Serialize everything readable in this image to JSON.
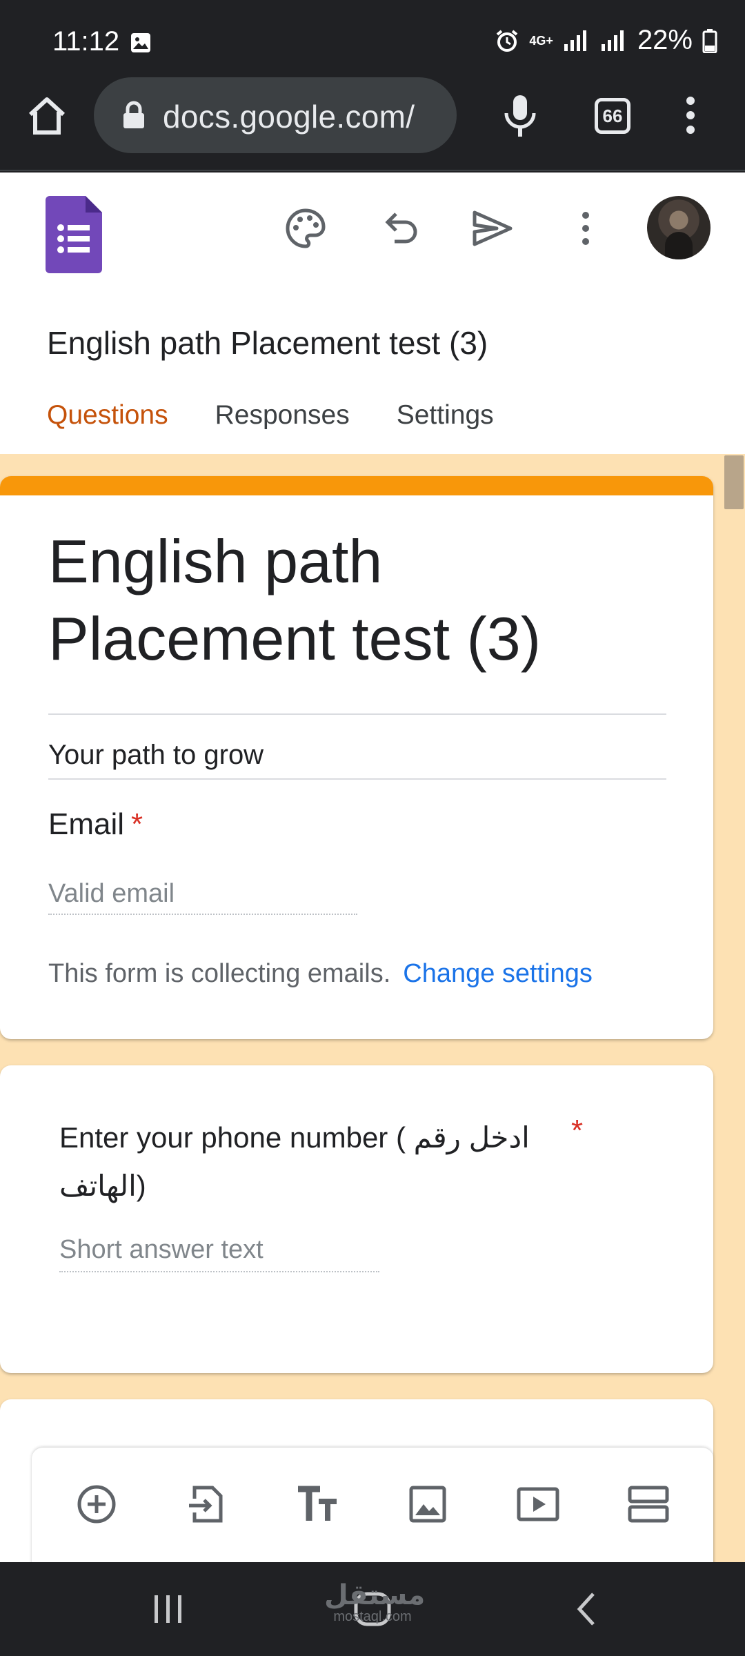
{
  "status_bar": {
    "time": "11:12",
    "network": "4G+",
    "battery": "22%"
  },
  "browser": {
    "url": "docs.google.com/",
    "tab_count": "66"
  },
  "document": {
    "title": "English path Placement test (3)",
    "tabs": [
      {
        "label": "Questions",
        "active": true
      },
      {
        "label": "Responses",
        "active": false
      },
      {
        "label": "Settings",
        "active": false
      }
    ]
  },
  "form": {
    "title": "English path Placement test (3)",
    "description": "Your path to grow",
    "email_label": "Email",
    "required_mark": "*",
    "email_placeholder": "Valid email",
    "collecting_note": "This form is collecting emails.",
    "change_settings": "Change settings"
  },
  "question": {
    "title": "Enter your phone number ( ادخل رقم الهاتف)",
    "required_mark": "*",
    "placeholder": "Short answer text"
  },
  "watermark": {
    "brand": "مستقل",
    "domain": "mostaql.com"
  },
  "colors": {
    "accent": "#c5520a",
    "theme_bar": "#f8970a",
    "canvas_bg": "#fde1b3",
    "forms_purple": "#673ab7",
    "link": "#1a73e8",
    "required": "#d93025"
  }
}
